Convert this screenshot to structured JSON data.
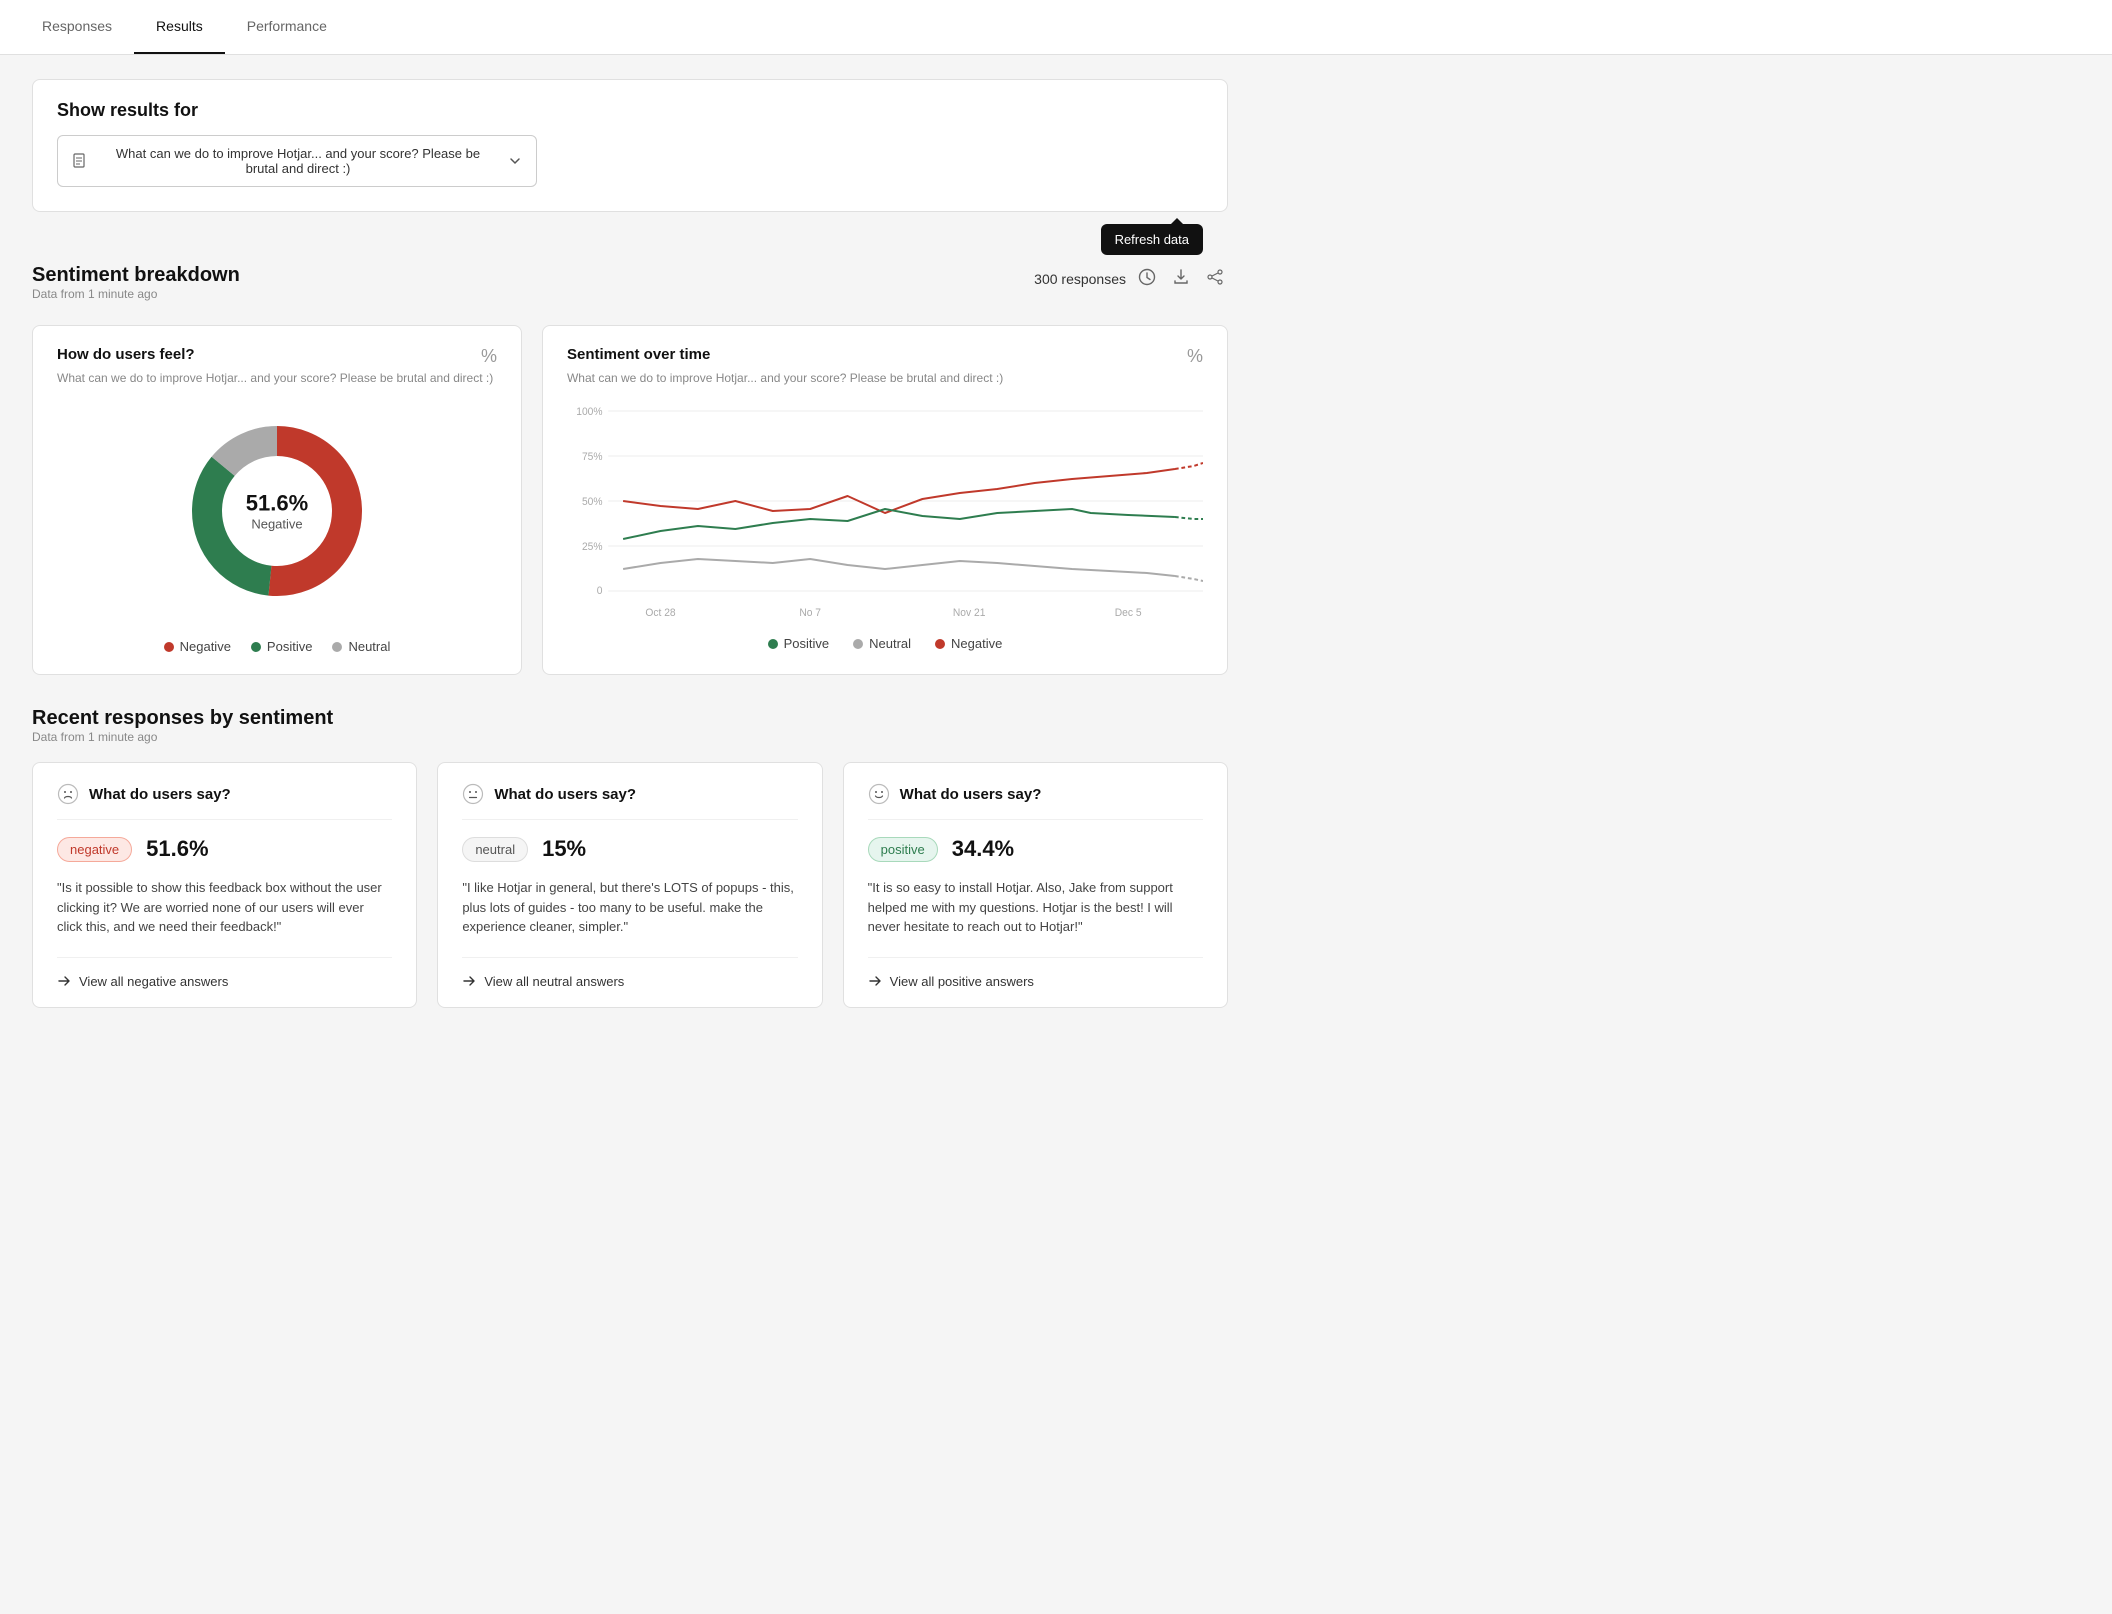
{
  "tabs": [
    {
      "id": "responses",
      "label": "Responses",
      "active": false
    },
    {
      "id": "results",
      "label": "Results",
      "active": true
    },
    {
      "id": "performance",
      "label": "Performance",
      "active": false
    }
  ],
  "show_results": {
    "title": "Show results for",
    "dropdown_value": "What can we do to improve Hotjar... and your score? Please be brutal and direct :)",
    "refresh_label": "Refresh data"
  },
  "sentiment_breakdown": {
    "title": "Sentiment breakdown",
    "subtitle": "Data from 1 minute ago",
    "responses_count": "300 responses"
  },
  "how_users_feel": {
    "title": "How do users feel?",
    "subtitle": "What can we do to improve Hotjar... and your score? Please be brutal and direct :)",
    "pct_toggle": "%",
    "center_pct": "51.6%",
    "center_label": "Negative",
    "donut": {
      "negative_pct": 51.6,
      "positive_pct": 34.4,
      "neutral_pct": 14.0
    },
    "legend": [
      {
        "label": "Negative",
        "color": "#c0392b"
      },
      {
        "label": "Positive",
        "color": "#2e7d4f"
      },
      {
        "label": "Neutral",
        "color": "#aaa"
      }
    ]
  },
  "sentiment_over_time": {
    "title": "Sentiment over time",
    "subtitle": "What can we do to improve Hotjar... and your score? Please be brutal and direct :)",
    "pct_toggle": "%",
    "y_labels": [
      "100%",
      "75%",
      "50%",
      "25%",
      "0"
    ],
    "x_labels": [
      "Oct 28",
      "No 7",
      "Nov 21",
      "Dec 5"
    ],
    "legend": [
      {
        "label": "Positive",
        "color": "#2e7d4f"
      },
      {
        "label": "Neutral",
        "color": "#aaa"
      },
      {
        "label": "Negative",
        "color": "#c0392b"
      }
    ]
  },
  "recent_responses": {
    "title": "Recent responses by sentiment",
    "subtitle": "Data from 1 minute ago",
    "cards": [
      {
        "header": "What do users say?",
        "icon": "negative-face",
        "badge": "negative",
        "badge_label": "negative",
        "pct": "51.6%",
        "quote": "\"Is it possible to show this feedback box without the user clicking it? We are worried none of our users will ever click this, and we need their feedback!\"",
        "link_label": "View all negative answers"
      },
      {
        "header": "What do users say?",
        "icon": "neutral-face",
        "badge": "neutral",
        "badge_label": "neutral",
        "pct": "15%",
        "quote": "\"I like Hotjar in general, but there's LOTS of popups - this, plus lots of guides - too many to be useful. make the experience cleaner, simpler.\"",
        "link_label": "View all neutral answers"
      },
      {
        "header": "What do users say?",
        "icon": "positive-face",
        "badge": "positive",
        "badge_label": "positive",
        "pct": "34.4%",
        "quote": "\"It is so easy to install Hotjar. Also, Jake from support helped me with my questions. Hotjar is the best! I will never hesitate to reach out to Hotjar!\"",
        "link_label": "View all positive answers"
      }
    ]
  }
}
